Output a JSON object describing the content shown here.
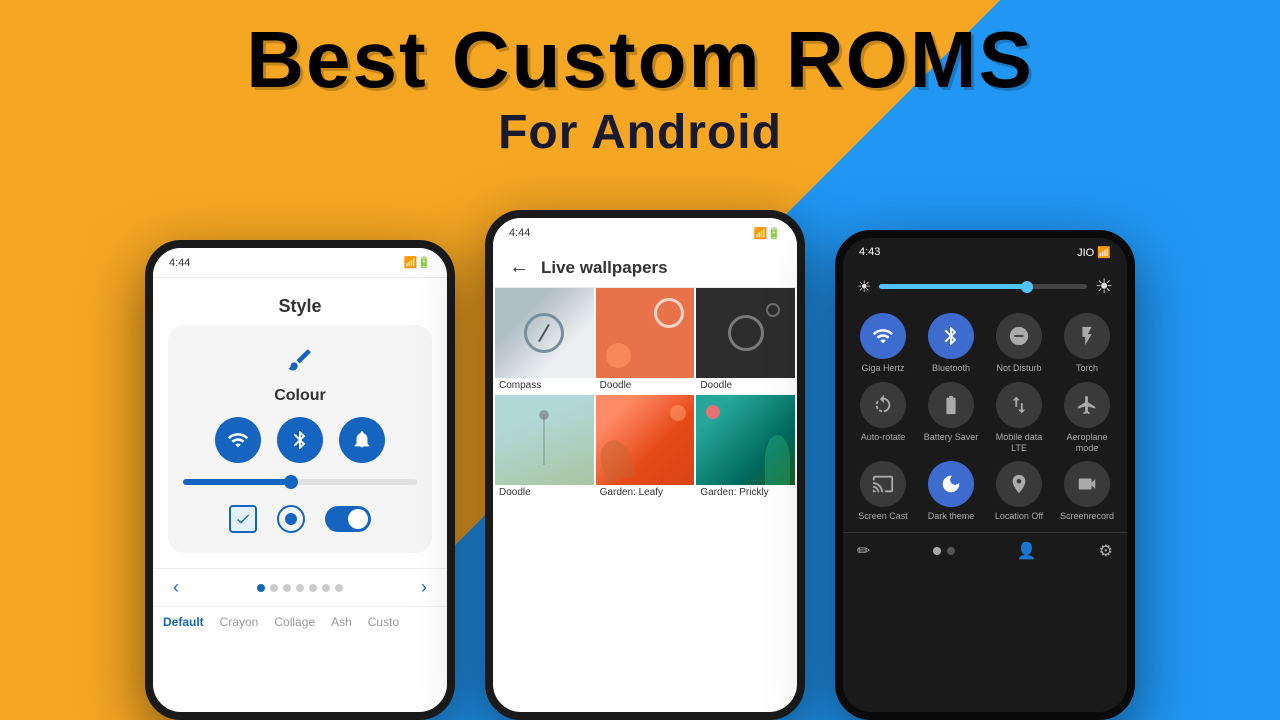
{
  "background": {
    "left_color": "#F5A623",
    "right_color": "#2196F3"
  },
  "title": {
    "main": "Best Custom ROMS",
    "sub": "For Android"
  },
  "phone_left": {
    "time": "4:44",
    "screen_title": "Style",
    "colour_label": "Colour",
    "nav_tabs": [
      "Default",
      "Crayon",
      "Collage",
      "Ash",
      "Custo"
    ]
  },
  "phone_mid": {
    "time": "4:44",
    "title": "Live wallpapers",
    "wallpapers": [
      {
        "name": "Compass",
        "col": 0,
        "row": 0
      },
      {
        "name": "Doodle",
        "col": 1,
        "row": 0
      },
      {
        "name": "Doodle",
        "col": 2,
        "row": 0
      },
      {
        "name": "Doodle",
        "col": 0,
        "row": 1
      },
      {
        "name": "Garden: Leafy",
        "col": 1,
        "row": 1
      },
      {
        "name": "Garden: Prickly",
        "col": 2,
        "row": 1
      }
    ]
  },
  "phone_right": {
    "time": "4:43",
    "carrier": "JIO",
    "tiles": [
      {
        "label": "Giga Hertz",
        "active": true,
        "icon": "wifi"
      },
      {
        "label": "Bluetooth",
        "active": true,
        "icon": "bluetooth"
      },
      {
        "label": "Not Disturb",
        "active": false,
        "icon": "dnd"
      },
      {
        "label": "Torch",
        "active": false,
        "icon": "torch"
      },
      {
        "label": "Auto-rotate",
        "active": false,
        "icon": "rotate"
      },
      {
        "label": "Battery Saver",
        "active": false,
        "icon": "battery"
      },
      {
        "label": "Mobile data LTE",
        "active": false,
        "icon": "data"
      },
      {
        "label": "Aeroplane mode",
        "active": false,
        "icon": "plane"
      },
      {
        "label": "Screen Cast",
        "active": false,
        "icon": "cast"
      },
      {
        "label": "Dark theme",
        "active": true,
        "icon": "dark"
      },
      {
        "label": "Location Off",
        "active": false,
        "icon": "location"
      },
      {
        "label": "Screenrecord",
        "active": false,
        "icon": "record"
      }
    ]
  }
}
